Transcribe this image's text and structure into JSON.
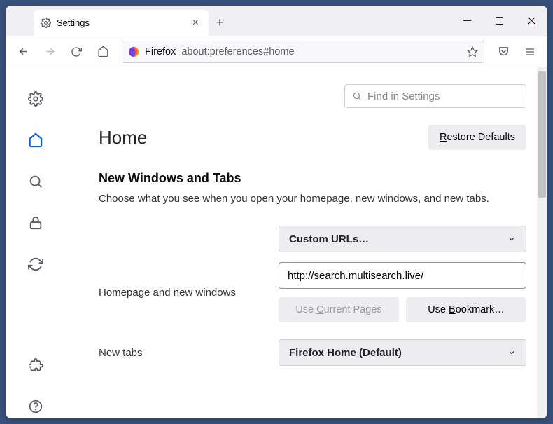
{
  "tab": {
    "title": "Settings"
  },
  "url": {
    "prefix": "Firefox",
    "path": "about:preferences#home"
  },
  "search": {
    "placeholder": "Find in Settings"
  },
  "page": {
    "title": "Home",
    "restore": "Restore Defaults"
  },
  "section": {
    "heading": "New Windows and Tabs",
    "desc": "Choose what you see when you open your homepage, new windows, and new tabs."
  },
  "homepage": {
    "dropdown": "Custom URLs…",
    "label": "Homepage and new windows",
    "value": "http://search.multisearch.live/",
    "useCurrent": "Use Current Pages",
    "useBookmark": "Use Bookmark…"
  },
  "newtabs": {
    "label": "New tabs",
    "dropdown": "Firefox Home (Default)"
  }
}
